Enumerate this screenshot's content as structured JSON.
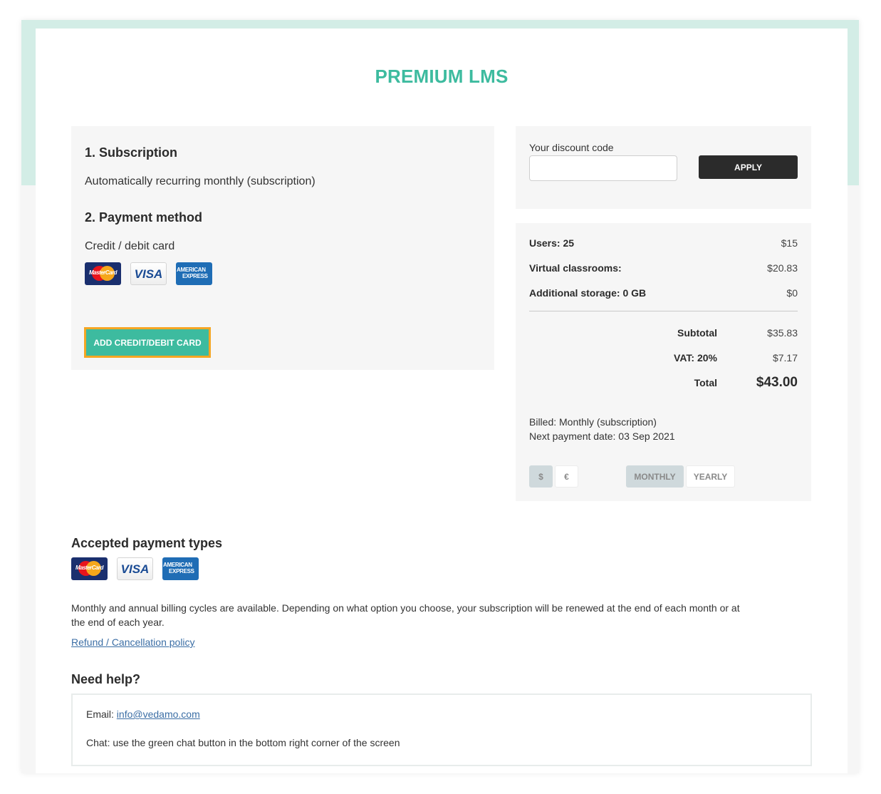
{
  "header": {
    "title": "PREMIUM LMS"
  },
  "subscription": {
    "heading": "1. Subscription",
    "description": "Automatically recurring monthly (subscription)"
  },
  "payment_method": {
    "heading": "2. Payment method",
    "type_label": "Credit / debit card",
    "card_logos": [
      {
        "name": "mastercard-logo",
        "text": "MasterCard"
      },
      {
        "name": "visa-logo",
        "text": "VISA"
      },
      {
        "name": "amex-logo",
        "line1": "AMERICAN",
        "line2": "EXPRESS"
      }
    ],
    "add_card_label": "ADD CREDIT/DEBIT CARD"
  },
  "discount": {
    "label": "Your discount code",
    "value": "",
    "placeholder": "",
    "apply_label": "APPLY"
  },
  "summary": {
    "items": [
      {
        "label": "Users: 25",
        "value": "$15"
      },
      {
        "label": "Virtual classrooms:",
        "value": "$20.83"
      },
      {
        "label": "Additional storage: 0 GB",
        "value": "$0"
      }
    ],
    "subtotal": {
      "label": "Subtotal",
      "value": "$35.83"
    },
    "vat": {
      "label": "VAT: 20%",
      "value": "$7.17"
    },
    "total": {
      "label": "Total",
      "value": "$43.00"
    },
    "billed": "Billed: Monthly (subscription)",
    "next_payment": "Next payment date: 03 Sep 2021",
    "currency_options": [
      {
        "label": "$",
        "active": true
      },
      {
        "label": "€",
        "active": false
      }
    ],
    "cycle_options": [
      {
        "label": "MONTHLY",
        "active": true
      },
      {
        "label": "YEARLY",
        "active": false
      }
    ]
  },
  "accepted": {
    "heading": "Accepted payment types",
    "description": "Monthly and annual billing cycles are available. Depending on what option you choose, your subscription will be renewed at the end of each month or at the end of each year.",
    "policy_link": "Refund / Cancellation policy"
  },
  "help": {
    "heading": "Need help?",
    "email_label": "Email: ",
    "email": "info@vedamo.com",
    "chat": "Chat: use the green chat button in the bottom right corner of the screen"
  },
  "colors": {
    "accent": "#3dbb9f",
    "highlight_border": "#f5a623",
    "mint_band": "#d3ede6",
    "apply_button": "#2b2b2b",
    "link": "#3b6ea5"
  }
}
